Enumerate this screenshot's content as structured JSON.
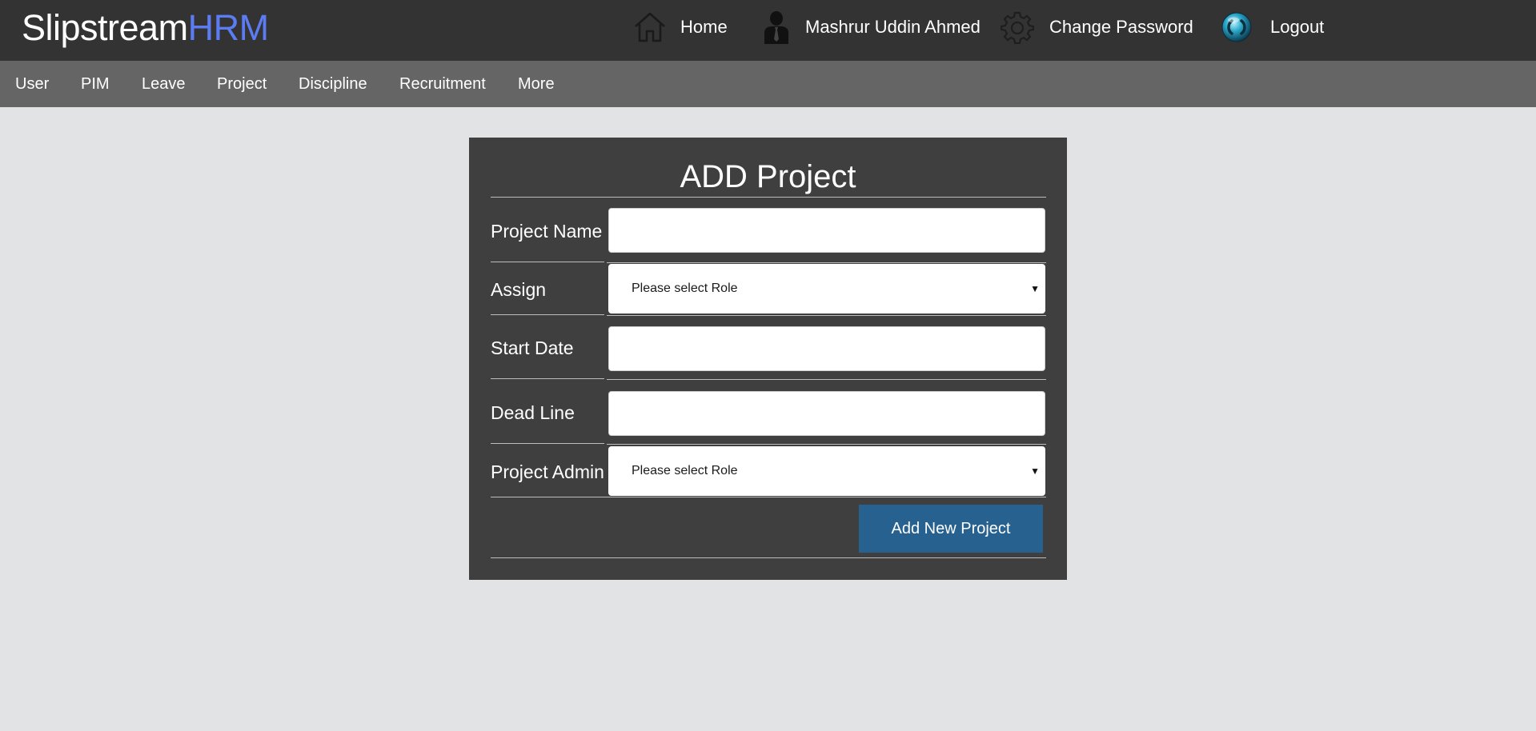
{
  "app": {
    "brand_part1": "Slipstream",
    "brand_part2": "HRM",
    "brand_accent_color": "#5c7cf2"
  },
  "header": {
    "nav": [
      {
        "label": "Home",
        "icon": "home-icon"
      },
      {
        "label": "Mashrur Uddin Ahmed",
        "icon": "user-silhouette-icon"
      },
      {
        "label": "Change Password",
        "icon": "gear-icon"
      },
      {
        "label": "Logout",
        "icon": "power-icon"
      }
    ]
  },
  "menu": {
    "items": [
      "User",
      "PIM",
      "Leave",
      "Project",
      "Discipline",
      "Recruitment",
      "More"
    ]
  },
  "form": {
    "title": "ADD Project",
    "fields": {
      "project_name": {
        "label": "Project Name",
        "value": ""
      },
      "assign": {
        "label": "Assign",
        "selected": "Please select Role"
      },
      "start_date": {
        "label": "Start Date",
        "value": ""
      },
      "dead_line": {
        "label": "Dead Line",
        "value": ""
      },
      "project_admin": {
        "label": "Project Admin",
        "selected": "Please select Role"
      }
    },
    "submit_label": "Add New Project",
    "submit_color": "#27618f"
  }
}
